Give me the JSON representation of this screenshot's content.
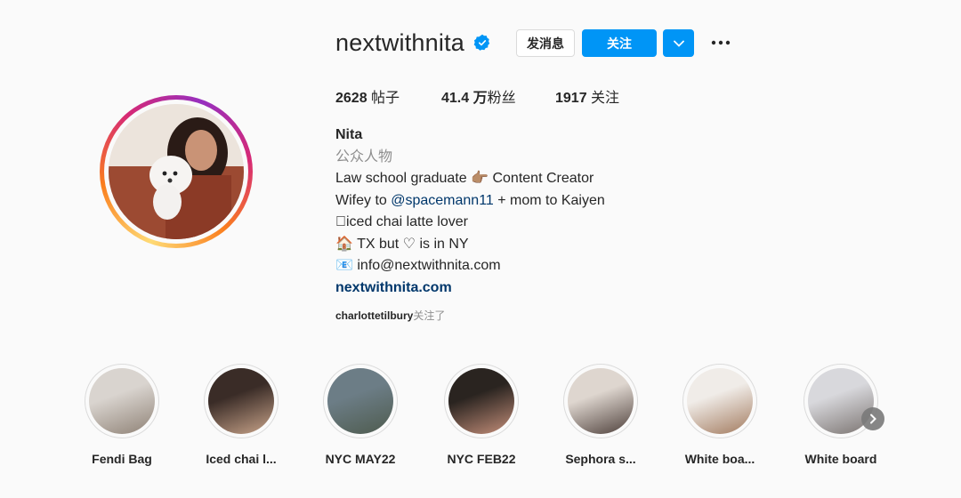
{
  "profile": {
    "username": "nextwithnita",
    "verified_icon": "verified-badge-icon",
    "message_label": "发消息",
    "follow_label": "关注",
    "more_icon": "more-horizontal-icon",
    "dropdown_icon": "chevron-down-icon"
  },
  "stats": {
    "posts_value": "2628",
    "posts_label": " 帖子",
    "followers_value": "41.4 万",
    "followers_label": "粉丝",
    "following_value": "1917",
    "following_label": " 关注"
  },
  "bio": {
    "name": "Nita",
    "category": "公众人物",
    "line1_pre": "Law school graduate ",
    "line1_emoji": "👉🏽",
    "line1_post": " Content Creator",
    "line2_pre": "Wifey to ",
    "line2_mention": "@spacemann11",
    "line2_post": " + mom to Kaiyen",
    "line3": "􏿾iced chai latte lover",
    "line4_emoji": "🏠",
    "line4_pre": " TX but ",
    "line4_heart": "♡",
    "line4_post": " is in NY",
    "line5_emoji": "📧",
    "line5_text": " info@nextwithnita.com",
    "website": "nextwithnita.com"
  },
  "followed_by": {
    "user": "charlottetilbury",
    "suffix": "关注了"
  },
  "highlights": [
    {
      "label": "Fendi Bag",
      "c1": "#d9d4cf",
      "c2": "#8f8276"
    },
    {
      "label": "Iced chai l...",
      "c1": "#3a2c27",
      "c2": "#c9a48a"
    },
    {
      "label": "NYC MAY22",
      "c1": "#6c7d86",
      "c2": "#4e5b4e"
    },
    {
      "label": "NYC FEB22",
      "c1": "#2a2420",
      "c2": "#c58f7a"
    },
    {
      "label": "Sephora s...",
      "c1": "#ded6cf",
      "c2": "#4d3f3a"
    },
    {
      "label": "White boa...",
      "c1": "#f0ece8",
      "c2": "#a27a5e"
    },
    {
      "label": "White board",
      "c1": "#d8d8dc",
      "c2": "#7a7370"
    }
  ],
  "colors": {
    "accent": "#0095f6",
    "link": "#00376b",
    "muted": "#8e8e8e"
  }
}
